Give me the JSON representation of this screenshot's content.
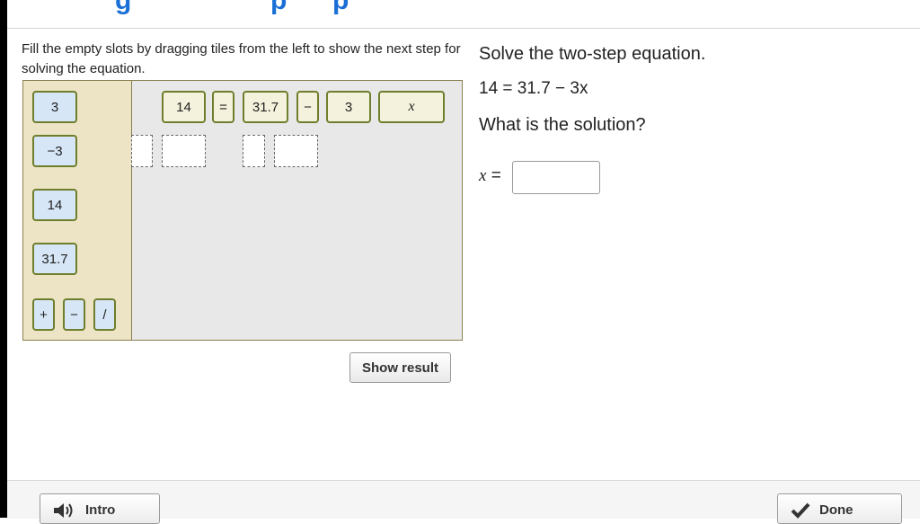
{
  "header": {
    "title_fragment_1": "g",
    "title_fragment_2": "p",
    "title_fragment_3": "p"
  },
  "instructions": "Fill the empty slots by dragging tiles from the left to show the next step for solving the equation.",
  "tray": {
    "tiles": [
      "3",
      "−3",
      "14",
      "31.7"
    ],
    "operators": [
      "+",
      "−",
      "/"
    ]
  },
  "equation_tiles": [
    "14",
    "=",
    "31.7",
    "−",
    "3",
    "x"
  ],
  "show_result_label": "Show result",
  "question": {
    "title": "Solve the two-step equation.",
    "equation": "14 = 31.7 − 3x",
    "prompt": "What is the solution?",
    "answer_variable": "x",
    "answer_equals": "=",
    "answer_value": ""
  },
  "footer": {
    "intro_label": "Intro",
    "done_label": "Done"
  },
  "colors": {
    "accent": "#1a6fd6",
    "tile_fill": "#d6e6f7",
    "tile_border": "#6f7e2c",
    "tray_bg": "#ece4c4",
    "board_bg": "#e8e8e8"
  },
  "icons": {
    "intro": "speaker-icon",
    "done": "checkmark-icon"
  }
}
